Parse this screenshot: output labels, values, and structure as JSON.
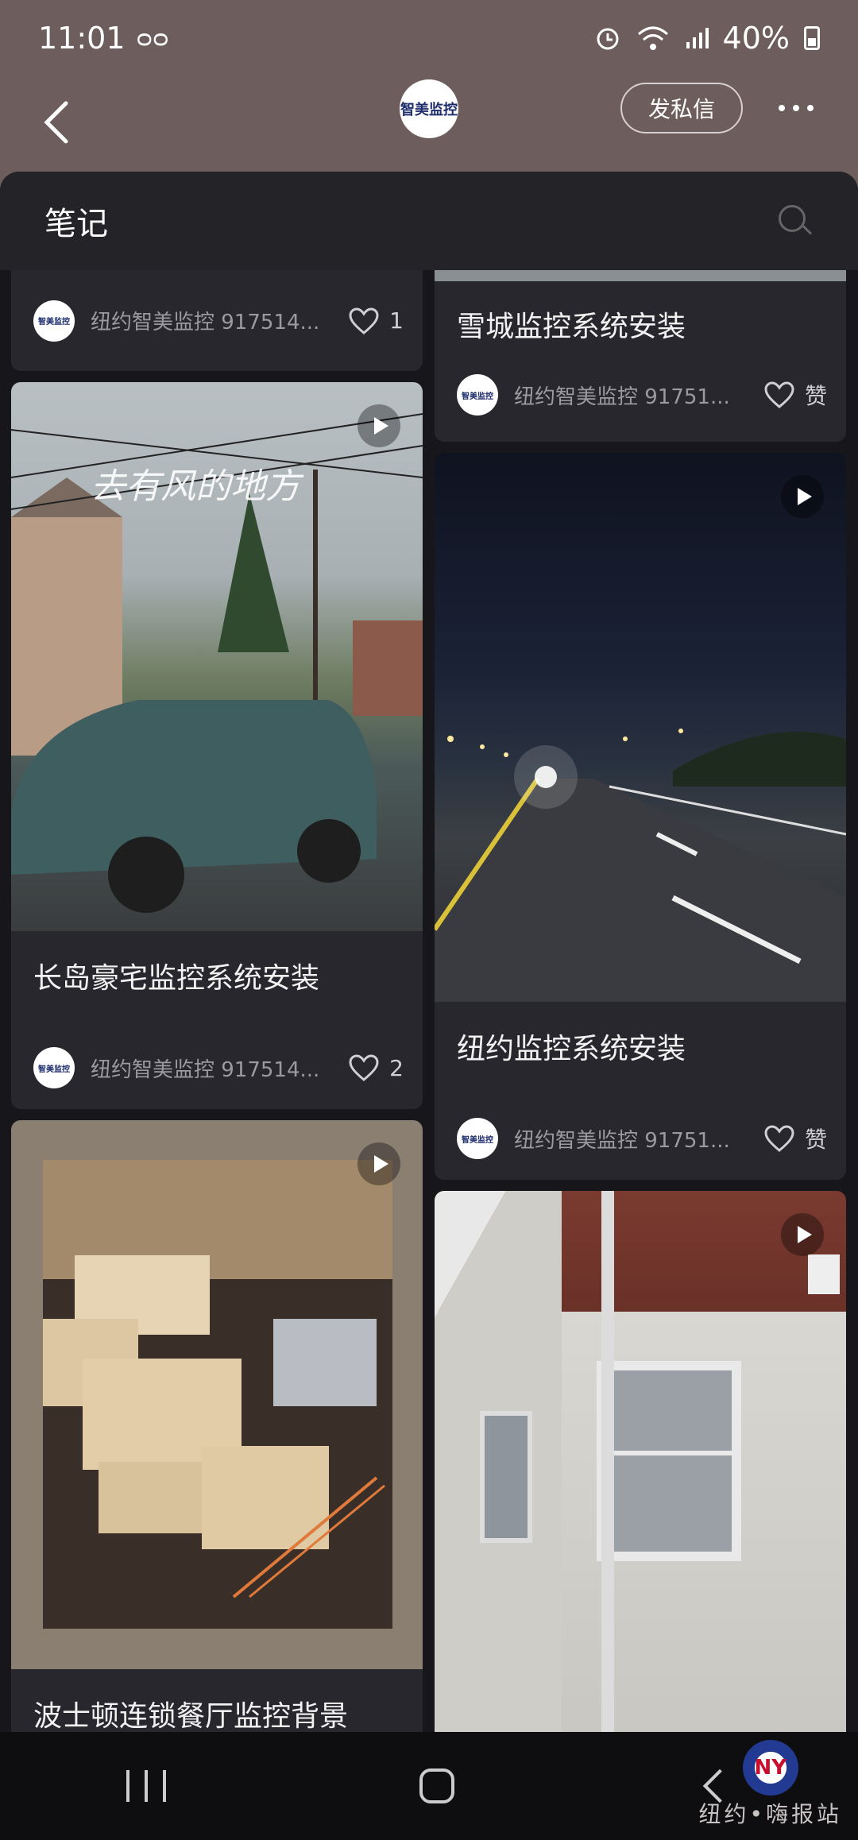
{
  "status_bar": {
    "time": "11:01",
    "battery": "40%"
  },
  "header": {
    "logo_text": "智美监控",
    "dm_label": "发私信"
  },
  "panel": {
    "title": "笔记"
  },
  "cards": [
    {
      "title": "",
      "author": "纽约智美监控 917514...",
      "likes": "1"
    },
    {
      "title": "雪城监控系统安装",
      "author": "纽约智美监控 91751...",
      "likes": "赞"
    },
    {
      "title": "长岛豪宅监控系统安装",
      "author": "纽约智美监控 917514...",
      "likes": "2",
      "overlay": "去有风的地方"
    },
    {
      "title": "纽约监控系统安装",
      "author": "纽约智美监控 91751...",
      "likes": "赞"
    },
    {
      "title": "波士顿连锁餐厅监控背景",
      "author": "",
      "likes": ""
    },
    {
      "title": "",
      "author": "",
      "likes": ""
    }
  ],
  "watermark": {
    "logo": "NY",
    "text": "纽约•嗨报站"
  },
  "colors": {
    "header_bg": "#6e5d5d",
    "panel_bg": "#17171b",
    "card_bg": "#27272d"
  }
}
